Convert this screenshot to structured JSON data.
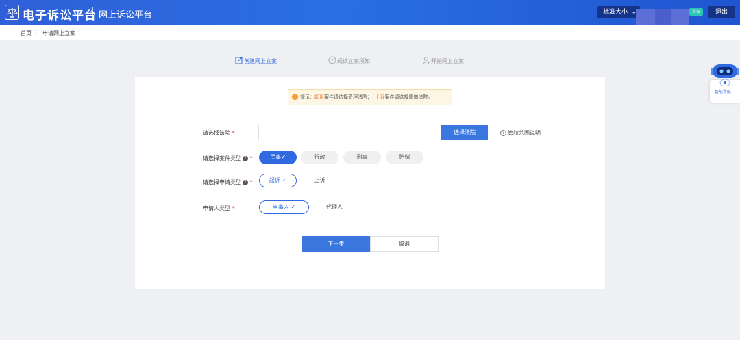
{
  "header": {
    "brand": "电子诉讼平台",
    "subtitle": "网上诉讼平台",
    "font_size_select": "标准大小",
    "role_badge": "实名",
    "logout": "退出",
    "colors": {
      "bar": "#2a6fe4",
      "dark_button": "#16338a"
    }
  },
  "breadcrumb": [
    {
      "label": "首页"
    },
    {
      "label": "申请网上立案"
    }
  ],
  "breadcrumb_separator": "/",
  "steps": [
    {
      "label": "创建网上立案",
      "state": "active",
      "icon": "edit-icon"
    },
    {
      "label": "阅读立案须知",
      "state": "pending",
      "icon": "question-circle-icon"
    },
    {
      "label": "开始网上立案",
      "state": "pending",
      "icon": "user-edit-icon"
    }
  ],
  "notice": {
    "prefix": "提示：",
    "part1_highlight": "起诉",
    "part1": "案件请选择受理法院；",
    "part2_highlight": "上诉",
    "part2": "案件请选择原审法院。"
  },
  "form": {
    "court": {
      "label": "请选择法院",
      "value": "",
      "button": "选择法院",
      "help_link": "管辖范围说明"
    },
    "case_type": {
      "label": "请选择案件类型",
      "options": [
        "民事",
        "行政",
        "刑事",
        "赔偿"
      ],
      "selected": "民事"
    },
    "apply_type": {
      "label": "请选择申请类型",
      "options": [
        "起诉",
        "上诉"
      ],
      "selected": "起诉"
    },
    "applicant_type": {
      "label": "申请人类型",
      "options": [
        "当事人",
        "代理人"
      ],
      "selected": "当事人"
    },
    "required_mark": "*",
    "next_button": "下一步",
    "cancel_button": "取消",
    "accent_color": "#2f6ae0"
  },
  "assistant": {
    "label": "智能导航",
    "icon": "robot-icon"
  }
}
